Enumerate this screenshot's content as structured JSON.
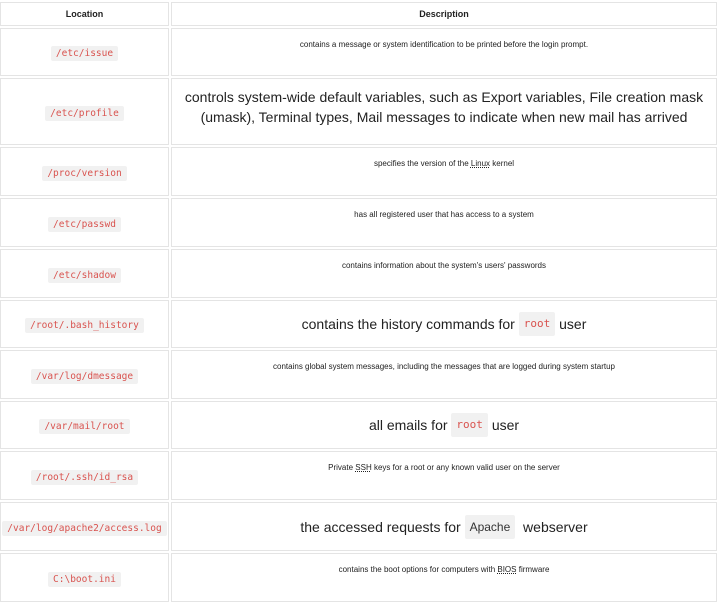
{
  "headers": {
    "location": "Location",
    "description": "Description"
  },
  "rows": [
    {
      "location": "/etc/issue",
      "desc": "contains a message or system identification to be printed before the login prompt."
    },
    {
      "location": "/etc/profile",
      "desc": "controls system-wide default variables, such as Export variables, File creation mask (umask), Terminal types, Mail messages to indicate when new mail has arrived"
    },
    {
      "location": "/proc/version",
      "desc_a": "specifies the version of the ",
      "desc_link": "Linux",
      "desc_b": " kernel"
    },
    {
      "location": "/etc/passwd",
      "desc": "has all registered user that has access to a system"
    },
    {
      "location": "/etc/shadow",
      "desc": "contains information about the system's users' passwords"
    },
    {
      "location": "/root/.bash_history",
      "desc_a": "contains the history commands for ",
      "desc_code": "root",
      "desc_b": " user"
    },
    {
      "location": "/var/log/dmessage",
      "desc": "contains global system messages, including the messages that are logged during system startup"
    },
    {
      "location": "/var/mail/root",
      "desc_a": "all emails for ",
      "desc_code": "root",
      "desc_b": " user"
    },
    {
      "location": "/root/.ssh/id_rsa",
      "desc_a": "Private ",
      "desc_link": "SSH",
      "desc_b": " keys for a root or any known valid user on the server"
    },
    {
      "location": "/var/log/apache2/access.log",
      "desc_a": "the accessed requests for ",
      "desc_code": "Apache",
      "desc_b": "  webserver"
    },
    {
      "location": "C:\\boot.ini",
      "desc_a": "contains the boot options for computers with ",
      "desc_link": "BIOS",
      "desc_b": " firmware"
    }
  ]
}
